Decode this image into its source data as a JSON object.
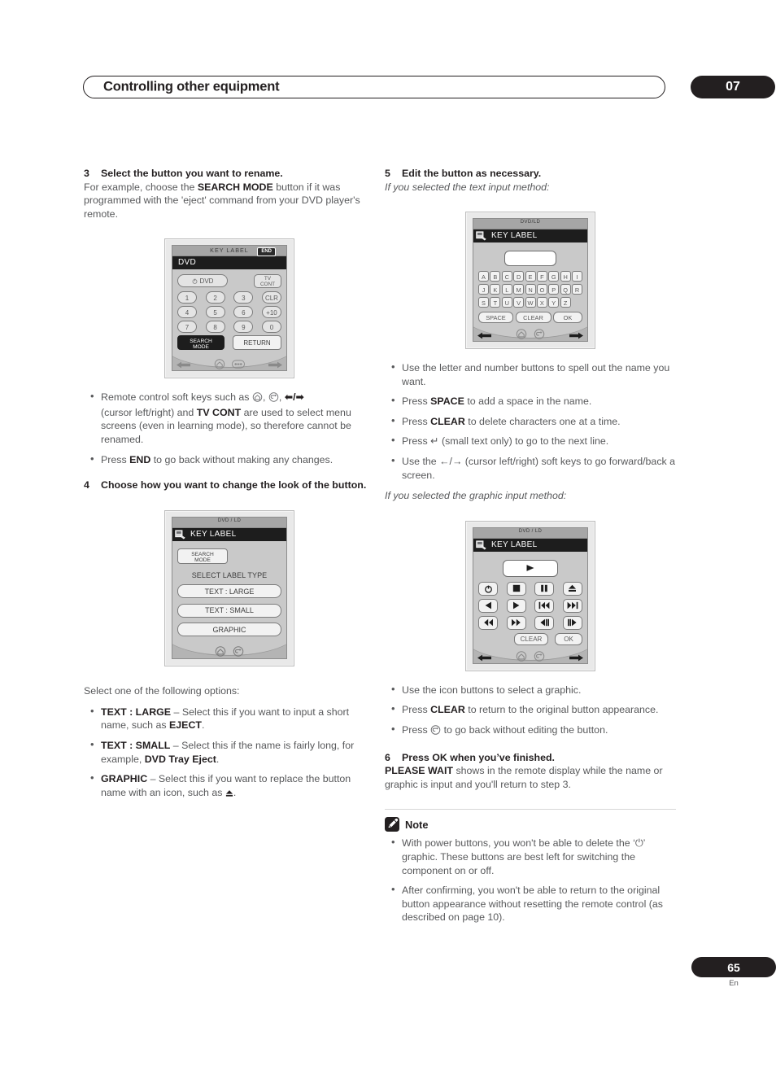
{
  "header": {
    "title": "Controlling other equipment",
    "chapter": "07"
  },
  "footer": {
    "page": "65",
    "lang": "En"
  },
  "left_column": {
    "step3": {
      "num": "3",
      "heading": "Select the button you want to rename.",
      "body_prefix": "For example, choose the ",
      "body_bold": "SEARCH MODE",
      "body_suffix": " button if it was programmed with the 'eject' command from your DVD player's remote."
    },
    "bullets_after_fig1": [
      {
        "t1": "Remote control soft keys such as ",
        "icons": "home-icon, back-icon, left-arrow / right-arrow",
        "t2": "(cursor left/right) and ",
        "b1": "TV CONT",
        "t3": " are used to select menu screens (even in learning mode), so therefore cannot be renamed."
      },
      {
        "t1": "Press ",
        "b1": "END",
        "t2": " to go back without making any changes."
      }
    ],
    "step4": {
      "num": "4",
      "heading": "Choose how you want to change the look of the button."
    },
    "select_intro": "Select one of the following options:",
    "options": [
      {
        "label": "TEXT : LARGE",
        "dash": " – ",
        "text_a": "Select this if you want to input a short name, such as ",
        "bold_b": "EJECT",
        "text_c": "."
      },
      {
        "label": "TEXT : SMALL",
        "dash": " – ",
        "text_a": "Select this if the name is fairly long, for example, ",
        "bold_b": "DVD Tray Eject",
        "text_c": "."
      },
      {
        "label": "GRAPHIC",
        "dash": " – ",
        "text_a": "Select this if you want to replace the button name with an icon, such as ",
        "bold_b": "",
        "text_c": "."
      }
    ]
  },
  "right_column": {
    "step5": {
      "num": "5",
      "heading": "Edit the button as necessary.",
      "sub_text": "If you selected the text input method:"
    },
    "text_bullets": [
      {
        "t1": "Use the letter and number buttons to spell out the name you want."
      },
      {
        "t1": "Press ",
        "b1": "SPACE",
        "t2": " to add a space in the name."
      },
      {
        "t1": "Press ",
        "b1": "CLEAR",
        "t2": " to delete characters one at a time."
      },
      {
        "t1": "Press ↵ (small text only) to go to the next line."
      },
      {
        "t1": "Use the ←/→ (cursor left/right) soft keys to go forward/back a screen."
      }
    ],
    "graphic_sub": "If you selected the graphic input method:",
    "graphic_bullets": [
      {
        "t1": "Use the icon buttons to select a graphic."
      },
      {
        "t1": "Press ",
        "b1": "CLEAR",
        "t2": " to return to the original button appearance."
      },
      {
        "t1": "Press ",
        "icon": "back-icon",
        "t2": " to go back without editing the button."
      }
    ],
    "step6": {
      "num": "6",
      "heading": "Press OK when you’ve finished.",
      "body_bold": "PLEASE WAIT",
      "body_text": " shows in the remote display while the name or graphic is input and you'll return to step 3."
    },
    "note": {
      "title": "Note",
      "icon": "pencil-icon",
      "items": [
        {
          "t1": "With power buttons, you won't be able to delete the ‘⏻’ graphic. These buttons are best left for switching the component on or off."
        },
        {
          "t1": "After confirming, you won't be able to return to the original button appearance without resetting the remote control (as described on page 10)."
        }
      ]
    }
  },
  "figures": {
    "fig1": {
      "name": "remote-screen-key-label-dvd",
      "title_bar": "KEY  LABEL",
      "end_badge": "END",
      "mode_bar": "DVD",
      "power_key": "DVD",
      "tv_cont": [
        "TV",
        "CONT"
      ],
      "num_rows": [
        [
          "1",
          "2",
          "3",
          "CLR"
        ],
        [
          "4",
          "5",
          "6",
          "+10"
        ],
        [
          "7",
          "8",
          "9",
          "0"
        ]
      ],
      "search_key": [
        "SEARCH",
        "MODE"
      ],
      "return_key": "RETURN",
      "nav_icons": [
        "home-icon",
        "remote-icon"
      ],
      "arrows": [
        "left-arrow-icon",
        "right-arrow-icon"
      ]
    },
    "fig2": {
      "name": "remote-screen-select-label-type",
      "mode_bar": "DVD / LD",
      "title_bar": "KEY LABEL",
      "edit_icon": "key-label-edit-icon",
      "search_key": [
        "SEARCH",
        "MODE"
      ],
      "prompt": "SELECT LABEL TYPE",
      "options": [
        "TEXT : LARGE",
        "TEXT : SMALL",
        "GRAPHIC"
      ],
      "nav_icons": [
        "home-icon",
        "back-icon"
      ]
    },
    "fig3": {
      "name": "remote-screen-text-input",
      "mode_bar": "DVD/LD",
      "title_bar": "KEY  LABEL",
      "edit_icon": "key-label-edit-icon",
      "keyboard_rows": [
        [
          "A",
          "B",
          "C",
          "D",
          "E",
          "F",
          "G",
          "H",
          "I"
        ],
        [
          "J",
          "K",
          "L",
          "M",
          "N",
          "O",
          "P",
          "Q",
          "R"
        ],
        [
          "S",
          "T",
          "U",
          "V",
          "W",
          "X",
          "Y",
          "Z"
        ]
      ],
      "fn_keys": [
        "SPACE",
        "CLEAR",
        "OK"
      ],
      "nav_icons": [
        "home-icon",
        "back-icon"
      ],
      "arrows": [
        "left-arrow-icon",
        "right-arrow-icon"
      ]
    },
    "fig4": {
      "name": "remote-screen-graphic-input",
      "mode_bar": "DVD / LD",
      "title_bar": "KEY LABEL",
      "edit_icon": "key-label-edit-icon",
      "preview_icon": "play-icon",
      "icon_rows": [
        [
          "power-icon",
          "stop-icon",
          "pause-icon",
          "eject-icon"
        ],
        [
          "cursor-left-icon",
          "cursor-right-icon",
          "previous-track-icon",
          "next-track-icon"
        ],
        [
          "rewind-icon",
          "fast-forward-icon",
          "step-back-icon",
          "step-forward-icon"
        ]
      ],
      "fn_keys": [
        "CLEAR",
        "OK"
      ],
      "nav_icons": [
        "home-icon",
        "back-icon"
      ],
      "arrows": [
        "left-arrow-icon",
        "right-arrow-icon"
      ]
    }
  }
}
